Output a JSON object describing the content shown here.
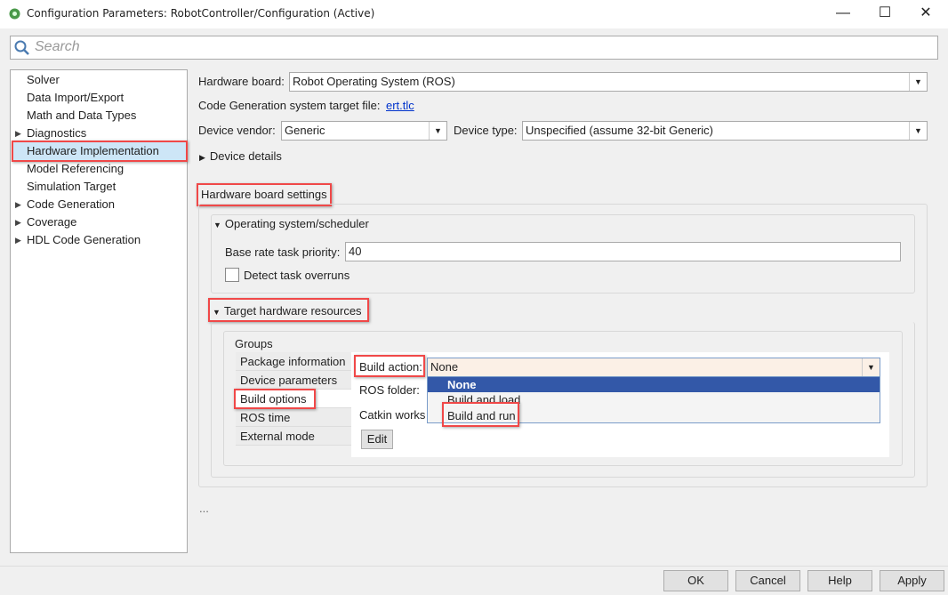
{
  "window": {
    "title": "Configuration Parameters: RobotController/Configuration (Active)",
    "minimize": "—",
    "maximize": "☐",
    "close": "✕"
  },
  "search": {
    "placeholder": "Search"
  },
  "tree": {
    "items": [
      {
        "label": "Solver",
        "expandable": false
      },
      {
        "label": "Data Import/Export",
        "expandable": false
      },
      {
        "label": "Math and Data Types",
        "expandable": false
      },
      {
        "label": "Diagnostics",
        "expandable": true
      },
      {
        "label": "Hardware Implementation",
        "expandable": false,
        "selected": true
      },
      {
        "label": "Model Referencing",
        "expandable": false
      },
      {
        "label": "Simulation Target",
        "expandable": false
      },
      {
        "label": "Code Generation",
        "expandable": true
      },
      {
        "label": "Coverage",
        "expandable": true
      },
      {
        "label": "HDL Code Generation",
        "expandable": true
      }
    ]
  },
  "main": {
    "hardware_board_label": "Hardware board:",
    "hardware_board_value": "Robot Operating System (ROS)",
    "codegen_label": "Code Generation system target file:",
    "codegen_link": "ert.tlc",
    "vendor_label": "Device vendor:",
    "vendor_value": "Generic",
    "type_label": "Device type:",
    "type_value": "Unspecified (assume 32-bit Generic)",
    "device_details": "Device details",
    "board_settings": "Hardware board settings",
    "os_section": "Operating system/scheduler",
    "base_rate_label": "Base rate task priority:",
    "base_rate_value": "40",
    "detect_overruns": "Detect task overruns",
    "target_resources": "Target hardware resources",
    "groups_label": "Groups",
    "groups": [
      "Package information",
      "Device parameters",
      "Build options",
      "ROS time",
      "External mode"
    ],
    "build_action_label": "Build action:",
    "build_action_value": "None",
    "build_action_options": [
      "None",
      "Build and load",
      "Build and run"
    ],
    "ros_folder_label": "ROS folder:",
    "catkin_label": "Catkin works",
    "edit_button": "Edit",
    "ellipsis": "..."
  },
  "footer": {
    "ok": "OK",
    "cancel": "Cancel",
    "help": "Help",
    "apply": "Apply"
  },
  "colors": {
    "annotation": "#f04848",
    "selection": "#3358a8",
    "tree_selection": "#cde6f7"
  }
}
